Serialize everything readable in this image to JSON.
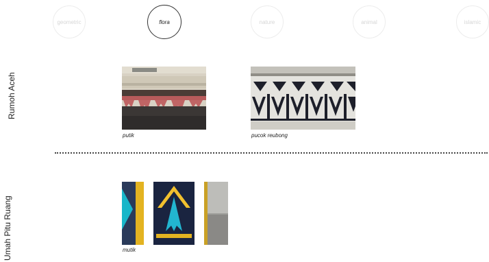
{
  "filters": [
    {
      "label": "geometric",
      "active": false
    },
    {
      "label": "flora",
      "active": true
    },
    {
      "label": "nature",
      "active": false
    },
    {
      "label": "animal",
      "active": false
    },
    {
      "label": "islamic",
      "active": false
    }
  ],
  "rows": [
    {
      "label": "Rumoh Aceh",
      "items": [
        {
          "caption": "putik"
        },
        {
          "caption": "pucok reubong"
        }
      ]
    },
    {
      "label": "Umah Pitu Ruang",
      "items": [
        {
          "caption": "mutik"
        }
      ]
    }
  ]
}
